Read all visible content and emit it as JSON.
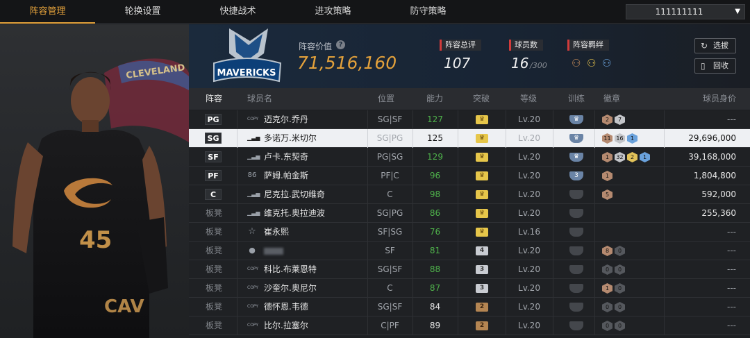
{
  "tabs": [
    "阵容管理",
    "轮换设置",
    "快捷战术",
    "进攻策略",
    "防守策略"
  ],
  "account": "111111111",
  "player_jersey": {
    "city": "CLEVELAND",
    "number": "45",
    "short": "CAV"
  },
  "team_logo_text": "MAVERICKS",
  "summary": {
    "lineup_value_label": "阵容价值",
    "lineup_value": "71,516,160",
    "overall_label": "阵容总评",
    "overall": "107",
    "players_label": "球员数",
    "players": "16",
    "players_max": "/300",
    "bond_label": "阵容羁绊",
    "pick_label": "选拔",
    "recycle_label": "回收"
  },
  "table": {
    "headers": [
      "阵容",
      "球员名",
      "位置",
      "能力",
      "突破",
      "等级",
      "训练",
      "徽章",
      "球员身价"
    ],
    "rows": [
      {
        "slot": "PG",
        "icon": "COPY",
        "name": "迈克尔.乔丹",
        "pos": "SG|SF",
        "rating": "127",
        "rating_color": "green",
        "brk": "crown",
        "level": "Lv.20",
        "train": "crown",
        "badges": [
          {
            "t": "br",
            "v": "2"
          },
          {
            "t": "sv",
            "v": "7"
          }
        ],
        "value": "---"
      },
      {
        "slot": "SG",
        "icon": "signal",
        "name": "多诺万.米切尔",
        "pos": "SG|PG",
        "rating": "125",
        "rating_color": "white",
        "brk": "crown",
        "level": "Lv.20",
        "train": "crown",
        "badges": [
          {
            "t": "br",
            "v": "11"
          },
          {
            "t": "sv",
            "v": "16"
          },
          {
            "t": "bl",
            "v": "1"
          }
        ],
        "value": "29,696,000",
        "selected": true
      },
      {
        "slot": "SF",
        "icon": "signal",
        "name": "卢卡.东契奇",
        "pos": "PG|SG",
        "rating": "129",
        "rating_color": "green",
        "brk": "crown",
        "level": "Lv.20",
        "train": "crown",
        "badges": [
          {
            "t": "br",
            "v": "1"
          },
          {
            "t": "sv",
            "v": "32"
          },
          {
            "t": "gd",
            "v": "2"
          },
          {
            "t": "bl",
            "v": "1"
          }
        ],
        "value": "39,168,000"
      },
      {
        "slot": "PF",
        "icon": "86",
        "name": "萨姆.帕金斯",
        "pos": "PF|C",
        "rating": "96",
        "rating_color": "green",
        "brk": "crown",
        "level": "Lv.20",
        "train": "3",
        "badges": [
          {
            "t": "br",
            "v": "1"
          }
        ],
        "value": "1,804,800"
      },
      {
        "slot": "C",
        "icon": "signal",
        "name": "尼克拉.武切维奇",
        "pos": "C",
        "rating": "98",
        "rating_color": "green",
        "brk": "crown",
        "level": "Lv.20",
        "train": "",
        "badges": [
          {
            "t": "br",
            "v": "5"
          }
        ],
        "value": "592,000"
      },
      {
        "slot": "板凳",
        "icon": "signal",
        "name": "维克托.奥拉迪波",
        "pos": "SG|PG",
        "rating": "86",
        "rating_color": "green",
        "brk": "crown",
        "level": "Lv.20",
        "train": "",
        "badges": [],
        "value": "255,360"
      },
      {
        "slot": "板凳",
        "icon": "star",
        "name": "崔永熙",
        "pos": "SF|SG",
        "rating": "76",
        "rating_color": "green",
        "brk": "crown",
        "level": "Lv.16",
        "train": "",
        "badges": [],
        "value": "---"
      },
      {
        "slot": "板凳",
        "icon": "person",
        "name": "",
        "blurred": true,
        "pos": "SF",
        "rating": "81",
        "rating_color": "green",
        "brk": "4",
        "level": "Lv.20",
        "train": "",
        "badges": [
          {
            "t": "br",
            "v": "8"
          },
          {
            "t": "dk",
            "v": "0"
          }
        ],
        "value": "---"
      },
      {
        "slot": "板凳",
        "icon": "COPY",
        "name": "科比.布莱恩特",
        "pos": "SG|SF",
        "rating": "88",
        "rating_color": "green",
        "brk": "3",
        "level": "Lv.20",
        "train": "",
        "badges": [
          {
            "t": "dk",
            "v": "0"
          },
          {
            "t": "dk",
            "v": "0"
          }
        ],
        "value": "---"
      },
      {
        "slot": "板凳",
        "icon": "COPY",
        "name": "沙奎尔.奥尼尔",
        "pos": "C",
        "rating": "87",
        "rating_color": "green",
        "brk": "3",
        "level": "Lv.20",
        "train": "",
        "badges": [
          {
            "t": "br",
            "v": "1"
          },
          {
            "t": "dk",
            "v": "0"
          }
        ],
        "value": "---"
      },
      {
        "slot": "板凳",
        "icon": "COPY",
        "name": "德怀恩.韦德",
        "pos": "SG|SF",
        "rating": "84",
        "rating_color": "white",
        "brk": "2",
        "level": "Lv.20",
        "train": "",
        "badges": [
          {
            "t": "dk",
            "v": "0"
          },
          {
            "t": "dk",
            "v": "0"
          }
        ],
        "value": "---"
      },
      {
        "slot": "板凳",
        "icon": "COPY",
        "name": "比尔.拉塞尔",
        "pos": "C|PF",
        "rating": "89",
        "rating_color": "white",
        "brk": "2",
        "level": "Lv.20",
        "train": "",
        "badges": [
          {
            "t": "dk",
            "v": "0"
          },
          {
            "t": "dk",
            "v": "0"
          }
        ],
        "value": "---"
      }
    ]
  },
  "colors": {
    "accent": "#e3a13b",
    "green": "#4fb34b",
    "selected_row": "#eef0f3"
  }
}
